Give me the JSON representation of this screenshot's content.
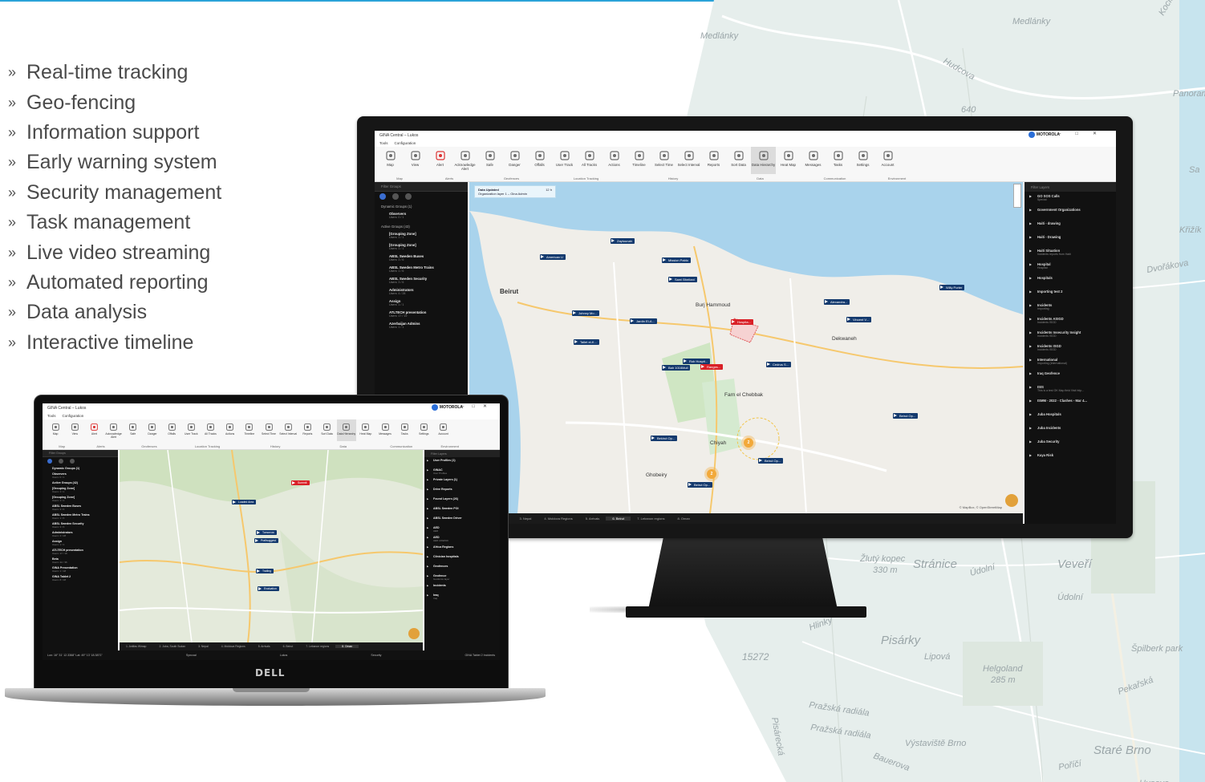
{
  "features": [
    "Real-time tracking",
    "Geo-fencing",
    "Information support",
    "Early warning system",
    "Security management",
    "Task management",
    "Live video streaming",
    "Automated reporting",
    "Data analysis",
    "Interactive timeline"
  ],
  "bullet_glyph": "»",
  "background_map": {
    "labels": [
      "Medlánky",
      "Medlánky",
      "Hudcova",
      "640",
      "Žlutý kopec",
      "330 m",
      "Stránice",
      "Pisárky",
      "Lipová",
      "Helgoland",
      "285 m",
      "Hlinky",
      "15272",
      "Pražská radiála",
      "Pražská radiála",
      "Výstaviště Brno",
      "Veveří",
      "Údolní",
      "Údolní",
      "Špilberk park",
      "Staré Brno",
      "Pekařská",
      "Bauerova",
      "Husova",
      "Poříčí",
      "Pisárecká",
      "Kociánka",
      "Panorama Kocián",
      "Křižík",
      "Sa",
      "Dvořákova"
    ],
    "water_color": "#c7e4ee"
  },
  "app": {
    "window_title": "GINA Central – Lukos",
    "brand": "MOTOROLA",
    "menu": [
      "Tools",
      "Configuration"
    ],
    "ribbon": [
      {
        "label": "Map",
        "icon": "map-icon"
      },
      {
        "label": "View",
        "icon": "eye-icon"
      },
      {
        "label": "Alert",
        "icon": "alert-icon"
      },
      {
        "label": "Acknowledge Alert",
        "icon": "acknowledge-alert-icon"
      },
      {
        "label": "Safe",
        "icon": "safe-icon"
      },
      {
        "label": "Danger",
        "icon": "danger-icon"
      },
      {
        "label": "Offalls",
        "icon": "offalls-icon"
      },
      {
        "label": "User Track",
        "icon": "user-track-icon"
      },
      {
        "label": "All Tracks",
        "icon": "all-tracks-icon"
      },
      {
        "label": "Actions",
        "icon": "actions-icon"
      },
      {
        "label": "Timeline",
        "icon": "timeline-icon"
      },
      {
        "label": "Select Time",
        "icon": "select-time-icon"
      },
      {
        "label": "Select Interval",
        "icon": "select-interval-icon"
      },
      {
        "label": "Reports",
        "icon": "reports-icon"
      },
      {
        "label": "Sort Data",
        "icon": "sort-data-icon"
      },
      {
        "label": "Data Hierarchy",
        "icon": "data-hierarchy-icon"
      },
      {
        "label": "Heat Map",
        "icon": "heat-map-icon"
      },
      {
        "label": "Messages",
        "icon": "messages-icon"
      },
      {
        "label": "Tasks",
        "icon": "tasks-icon"
      },
      {
        "label": "Settings",
        "icon": "settings-icon"
      },
      {
        "label": "Account",
        "icon": "account-icon"
      }
    ],
    "ribbon_groups": [
      "Map",
      "Alerts",
      "Geofences",
      "Location Tracking",
      "History",
      "Data",
      "Communication",
      "Environment"
    ],
    "left_panel": {
      "filter_placeholder": "Filter Groups",
      "sections": [
        {
          "title": "Dynamic Groups (1)",
          "rows": [
            {
              "name": "Observers",
              "sub": "Users: 0 / 1"
            }
          ]
        },
        {
          "title": "Active Groups (43)",
          "rows": [
            {
              "name": "[Grouping Zone]",
              "sub": "Users: 1 / 1"
            },
            {
              "name": "[Grouping Zone]",
              "sub": "Users: 1 / 1"
            },
            {
              "name": "ABSL Sweden Buses",
              "sub": "Users: 3 / 6"
            },
            {
              "name": "ABSL Sweden Metro Trains",
              "sub": "Users: 1 / 6"
            },
            {
              "name": "ABSL Sweden Security",
              "sub": "Users: 3 / 6"
            },
            {
              "name": "Administrators",
              "sub": "Users: 4 / 28"
            },
            {
              "name": "Assign",
              "sub": "Users: 1 / 1"
            },
            {
              "name": "ATLTECH presentation",
              "sub": "Users: 17 / 19"
            },
            {
              "name": "Azerbaijan Admins",
              "sub": "Users: 1 / 1"
            }
          ]
        }
      ]
    },
    "right_panel": {
      "filter_placeholder": "Filter Layers",
      "rows": [
        {
          "name": "GO SOS Calls",
          "sub": "Special"
        },
        {
          "name": "Government Organizations",
          "sub": ""
        },
        {
          "name": "Haiti - drawing",
          "sub": ""
        },
        {
          "name": "Haiti - Drawing",
          "sub": ""
        },
        {
          "name": "Haiti Situation",
          "sub": "Incidents reports from Haiti"
        },
        {
          "name": "Hospital",
          "sub": "Hospital"
        },
        {
          "name": "Hospitals",
          "sub": ""
        },
        {
          "name": "Importing test 2",
          "sub": ""
        },
        {
          "name": "Incidents",
          "sub": "Importing"
        },
        {
          "name": "Incidents ASIGD",
          "sub": "Incidents ISGD"
        },
        {
          "name": "Incidents Insecurity Insight",
          "sub": "Incidents ISGD"
        },
        {
          "name": "Incidents ISGD",
          "sub": "Incidents ISGD"
        },
        {
          "name": "International",
          "sub": "Importing (international)"
        },
        {
          "name": "Iraq Geofence",
          "sub": ""
        },
        {
          "name": "ISIS",
          "sub": "This is a test OK Map field Visit http..."
        },
        {
          "name": "ISMM - 2022 - Clashes - Mar 4...",
          "sub": ""
        },
        {
          "name": "Juba Hospitals",
          "sub": ""
        },
        {
          "name": "Juba Incidents",
          "sub": ""
        },
        {
          "name": "Juba Security",
          "sub": ""
        },
        {
          "name": "Kaya Risk",
          "sub": ""
        }
      ]
    },
    "map_popup": {
      "title": "Data Updated",
      "sub": "Organization layer 1 – Gina Admin",
      "count": "12 h"
    },
    "map_labels": [
      "Beirut",
      "Burj Hammoud",
      "Dekwaneh",
      "Farn el Chebbak",
      "Chiyah",
      "Ghobeiry"
    ],
    "map_pins": [
      "American U",
      "Zaytounah",
      "Mission Pablo",
      "Sami Bheitani",
      "Johnny Mo...",
      "Jardin El-A...",
      "Tallet el-K...",
      "Hospita...",
      "Rob Hospit...",
      "Alexandra...",
      "Vincent V...",
      "Willy Porter",
      "Bah 1016Mull",
      "Ranges...",
      "Cedrus S...",
      "Beirut Op...",
      "Beirut Op...",
      "Beirut Op...",
      "Bekirut Op..."
    ],
    "map_clusters": [
      "2",
      "2"
    ],
    "map_attribution": "© MapBox, © OpenStreetMap",
    "bottom_tabs": [
      "2. Juba, South Sudan",
      "3. Nepal",
      "4. Moldova Regions",
      "5. Arrivals",
      "6. Beirut",
      "7. Lebanon regions",
      "8. Oman"
    ]
  },
  "laptop": {
    "brand": "DELL",
    "left_panel_rows": [
      {
        "name": "Dynamic Groups (1)",
        "sub": ""
      },
      {
        "name": "Observers",
        "sub": "Users: 0 / 1"
      },
      {
        "name": "Active Groups (42)",
        "sub": ""
      },
      {
        "name": "[Grouping Zone]",
        "sub": "Users: 1 / 1"
      },
      {
        "name": "[Grouping Zone]",
        "sub": "Users: 1 / 1"
      },
      {
        "name": "ABSL Sweden Buses",
        "sub": "Users: 3 / 6"
      },
      {
        "name": "ABSL Sweden Metro Trains",
        "sub": "Users: 1 / 6"
      },
      {
        "name": "ABSL Sweden Security",
        "sub": "Users: 3 / 6"
      },
      {
        "name": "Administrators",
        "sub": "Users: 4 / 28"
      },
      {
        "name": "Assign",
        "sub": "Users: 1 / 1"
      },
      {
        "name": "ATLTECH presentation",
        "sub": "Users: 17 / 19"
      },
      {
        "name": "Beta",
        "sub": "Users: 22 / 36"
      },
      {
        "name": "GINA Presentation",
        "sub": "Users: 1 / 18"
      },
      {
        "name": "GINA Tablet 2",
        "sub": "Users: 8 / 18"
      }
    ],
    "right_panel_rows": [
      {
        "name": "User Profiles (1)",
        "sub": ""
      },
      {
        "name": "GINAC",
        "sub": "User Profiles"
      },
      {
        "name": "Private Layers (1)",
        "sub": ""
      },
      {
        "name": "Drive Reports",
        "sub": ""
      },
      {
        "name": "Found Layers (26)",
        "sub": ""
      },
      {
        "name": "ABSL Sweden POI",
        "sub": ""
      },
      {
        "name": "ABSL Sweden Driver",
        "sub": ""
      },
      {
        "name": "AED",
        "sub": "AED"
      },
      {
        "name": "AED",
        "sub": "AED LIFEPAK"
      },
      {
        "name": "Africa Regions",
        "sub": ""
      },
      {
        "name": "Clinician hospitals",
        "sub": ""
      },
      {
        "name": "Geofences",
        "sub": ""
      },
      {
        "name": "Geofence",
        "sub": "Geofence layer"
      },
      {
        "name": "Incidents",
        "sub": ""
      },
      {
        "name": "Iraq",
        "sub": "Iraq"
      }
    ],
    "map_pins": [
      "Loaded Area",
      "Summit",
      "Tomorrow",
      "Prafisuggest",
      "Trailing",
      "Evaluation"
    ],
    "bottom_tabs": [
      "1. Antifas Wimap",
      "2. Juba, South Sudan",
      "3. Nepal",
      "4. Moldova Regions",
      "5. Arrivals",
      "6. Beirut",
      "7. Lebanon regions",
      "8. Oman"
    ],
    "status": [
      "Lon: 16° 31' 12.3368\" Lat: 49° 13' 18.3871\"",
      "Syncoal",
      "Lukos",
      "Security",
      "GINA Tablet 2 Incidents"
    ]
  }
}
